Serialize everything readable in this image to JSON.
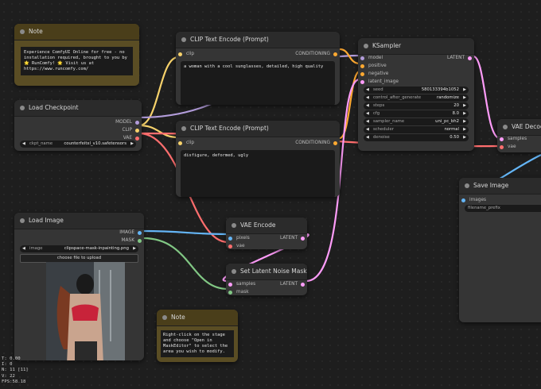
{
  "colors": {
    "clip": "#f7d26b",
    "vae": "#ff6e6e",
    "image": "#64b5f6",
    "mask": "#81c784",
    "latent": "#ff9cf9",
    "conditioning": "#ffa931",
    "model": "#b39ddb"
  },
  "note1": {
    "title": "Note",
    "text": "Experience ComfyUI Online for free - no installation required, brought to you by 🌟 RunComfy! 🌟 Visit us at https://www.runcomfy.com/"
  },
  "load_checkpoint": {
    "title": "Load Checkpoint",
    "outputs": [
      "MODEL",
      "CLIP",
      "VAE"
    ],
    "ckpt_label": "ckpt_name",
    "ckpt_value": "counterfeitxl_v10.safetensors"
  },
  "clip_pos": {
    "title": "CLIP Text Encode (Prompt)",
    "input": "clip",
    "output": "CONDITIONING",
    "text": "a woman with a cool sunglasses, detailed, high quality"
  },
  "clip_neg": {
    "title": "CLIP Text Encode (Prompt)",
    "input": "clip",
    "output": "CONDITIONING",
    "text": "disfigure, deformed, ugly"
  },
  "ksampler": {
    "title": "KSampler",
    "inputs": [
      "model",
      "positive",
      "negative",
      "latent_image"
    ],
    "output": "LATENT",
    "widgets": [
      {
        "label": "seed",
        "value": "580133394b1052"
      },
      {
        "label": "control_after_generate",
        "value": "randomize"
      },
      {
        "label": "steps",
        "value": "20"
      },
      {
        "label": "cfg",
        "value": "8.0"
      },
      {
        "label": "sampler_name",
        "value": "uni_pc_bh2"
      },
      {
        "label": "scheduler",
        "value": "normal"
      },
      {
        "label": "denoise",
        "value": "0.50"
      }
    ]
  },
  "vae_decode": {
    "title": "VAE Decode",
    "inputs": [
      "samples",
      "vae"
    ]
  },
  "save_image": {
    "title": "Save Image",
    "input": "images",
    "prefix": "filename_prefix"
  },
  "load_image": {
    "title": "Load Image",
    "outputs": [
      "IMAGE",
      "MASK"
    ],
    "image_label": "image",
    "image_value": "clipspace-mask-inpainting.png",
    "upload_label": "choose file to upload"
  },
  "vae_encode": {
    "title": "VAE Encode",
    "inputs": [
      "pixels",
      "vae"
    ],
    "output": "LATENT"
  },
  "latent_mask": {
    "title": "Set Latent Noise Mask",
    "inputs": [
      "samples",
      "mask"
    ],
    "output": "LATENT"
  },
  "note2": {
    "title": "Note",
    "text": "Right-click on the stage and choose \"Open in MaskEditor\" to select the area you wish to modify."
  },
  "stats": [
    "T: 0.00",
    "I: 0",
    "N: 11 [11]",
    "V: 22",
    "FPS:58.18"
  ]
}
